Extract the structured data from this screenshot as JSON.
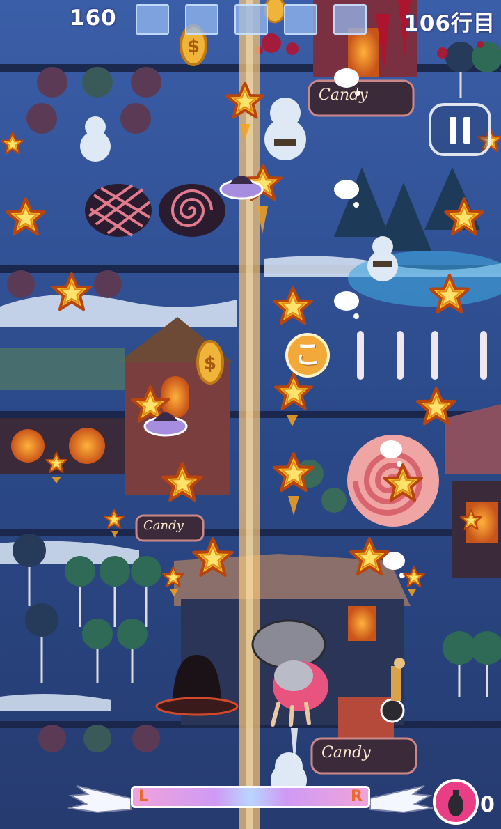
{
  "hud": {
    "score": "160",
    "line_count": "106行目",
    "coin_symbol": "$"
  },
  "bubble": {
    "char": "こ"
  },
  "signs": {
    "shop1": "Candy",
    "shop2": "Candy",
    "shop3": "Candy"
  },
  "meter": {
    "left_label": "L",
    "right_label": "R"
  },
  "bomb": {
    "count": "0"
  },
  "icons": [
    "star-icon",
    "coin-icon",
    "pause-icon",
    "bomb-icon",
    "wing-icon",
    "ufo-icon",
    "snowman-icon"
  ],
  "colors": {
    "background": "#1d2d55",
    "lane": "#f1c27a",
    "star": "#f6c21d",
    "bomb": "#e93e86"
  }
}
